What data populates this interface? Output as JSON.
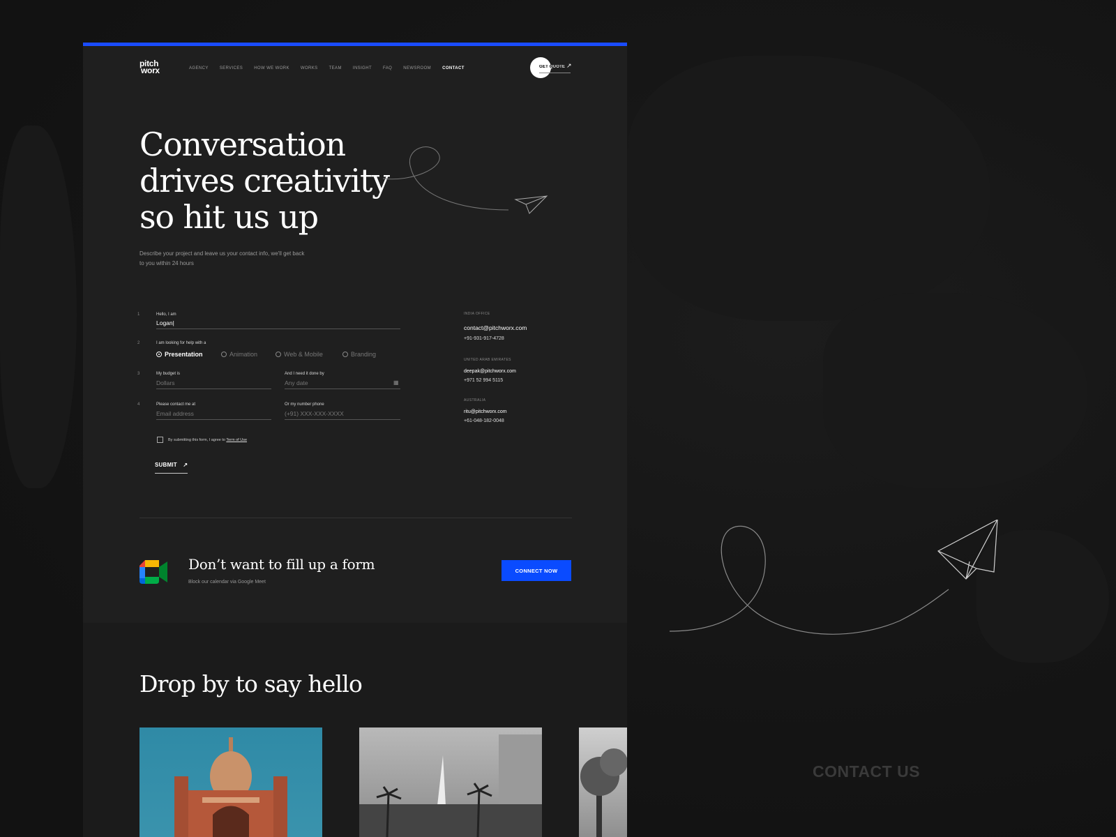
{
  "brand": {
    "logo_line1": "pitch",
    "logo_line2": "worx",
    "accent_color": "#1a4cff",
    "button_color": "#0a4bff"
  },
  "nav": {
    "items": [
      "AGENCY",
      "SERVICES",
      "HOW WE WORK",
      "WORKS",
      "TEAM",
      "INSIGHT",
      "FAQ",
      "NEWSROOM",
      "CONTACT"
    ],
    "active": "CONTACT",
    "quote_label": "GET QUOTE",
    "quote_icon": "arrow-up-right-icon"
  },
  "hero": {
    "title_line1": "Conversation",
    "title_line2": "drives creativity",
    "title_line3": "so hit us up",
    "subtitle_line1": "Describe your project and leave us your contact info, we'll get back",
    "subtitle_line2": "to you within 24 hours"
  },
  "form": {
    "step1": "1",
    "name_label": "Hello, I am",
    "name_value": "Logan|",
    "step2": "2",
    "help_label": "I am looking for help with a",
    "options": [
      "Presentation",
      "Animation",
      "Web & Mobile",
      "Branding"
    ],
    "selected_option": "Presentation",
    "step3": "3",
    "budget_label": "My budget is",
    "budget_placeholder": "Dollars",
    "date_label": "And I need it done by",
    "date_placeholder": "Any date",
    "step4": "4",
    "email_label": "Please contact me at",
    "email_placeholder": "Email address",
    "phone_label": "Or my number phone",
    "phone_placeholder": "(+91) XXX-XXX-XXXX",
    "terms_text": "By submitting this form, I agree to",
    "terms_link": "Term of Use",
    "submit_label": "SUBMIT"
  },
  "offices": [
    {
      "label": "INDIA OFFICE",
      "email": "contact@pitchworx.com",
      "phone": "+91-931-917-4728"
    },
    {
      "label": "UNITED ARAB EMIRATES",
      "email": "deepak@pitchworx.com",
      "phone": "+971 52 994 5115"
    },
    {
      "label": "AUSTRALIA",
      "email": "ritu@pitchworx.com",
      "phone": "+61-048-182-0048"
    }
  ],
  "meet": {
    "title": "Don’t want to fill up a form",
    "subtitle": "Block our calendar via Google Meet",
    "button": "CONNECT NOW",
    "icon": "google-meet-icon"
  },
  "lower": {
    "title": "Drop by to say hello"
  },
  "caption": "CONTACT US"
}
